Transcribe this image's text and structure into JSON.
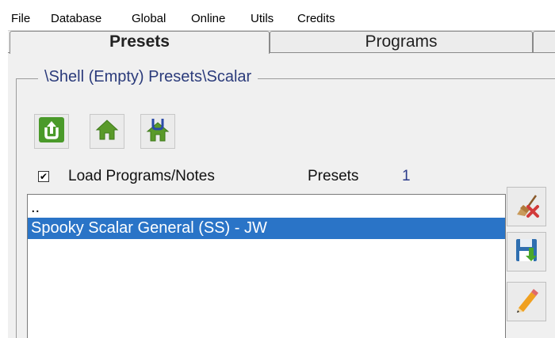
{
  "menubar": {
    "items": [
      "File",
      "Database",
      "Global",
      "Online",
      "Utils",
      "Credits"
    ]
  },
  "tabs": [
    {
      "label": "Presets",
      "active": true
    },
    {
      "label": "Programs",
      "active": false
    }
  ],
  "group": {
    "title": "\\Shell (Empty) Presets\\Scalar"
  },
  "toolbar": {
    "buttons": [
      {
        "icon": "up-arrow-icon",
        "color": "#4a9a2a"
      },
      {
        "icon": "home-icon",
        "color": "#5a9a2a"
      },
      {
        "icon": "home-up-icon",
        "color": "#5a9a2a"
      }
    ]
  },
  "options": {
    "load_checkbox_checked": true,
    "load_label": "Load Programs/Notes",
    "presets_label": "Presets",
    "presets_count": "1"
  },
  "list": {
    "rows": [
      {
        "text": "..",
        "selected": false
      },
      {
        "text": "Spooky Scalar General (SS) - JW",
        "selected": true
      }
    ],
    "selection_color": "#2a74c7"
  },
  "side_buttons": [
    {
      "icon": "broom-delete-icon"
    },
    {
      "icon": "save-disk-icon"
    },
    {
      "icon": "pencil-edit-icon"
    }
  ],
  "colors": {
    "title_blue": "#2b3b7b",
    "accent_green": "#5a9a2a"
  }
}
